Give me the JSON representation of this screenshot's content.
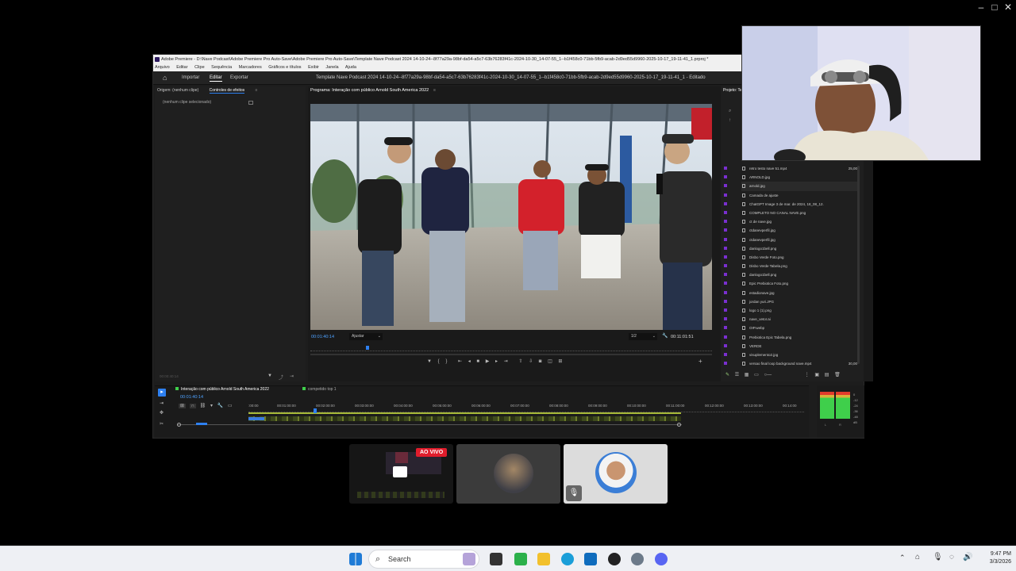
{
  "premiere": {
    "title": "Adobe Premiere - D:\\Nave Podcast\\Adobe Premiere Pro Auto-Save\\Adobe Premiere Pro Auto-Save\\Template Nave Podcast 2024 14-10-24--8f77a29a-98bf-da54-a5c7-63b76283f41c-2024-10-30_14-07-55_1--b1f458c0-71bb-5fb9-acab-2d9ed55d9960-2025-10-17_19-11-41_1.prproj *",
    "menu": [
      "Arquivo",
      "Editar",
      "Clipe",
      "Sequência",
      "Marcadores",
      "Gráficos e títulos",
      "Exibir",
      "Janela",
      "Ajuda"
    ],
    "workspace_tabs": [
      "Importar",
      "Editar",
      "Exportar"
    ],
    "document_title": "Template Nave Podcast 2024 14-10-24--8f77a29a-98bf-da54-a5c7-63b76283f41c-2024-10-30_14-07-55_1--b1f458c0-71bb-5fb9-acab-2d9ed55d9960-2025-10-17_19-11-41_1 - Editado",
    "left_panel": {
      "tabs": [
        "Origem: (nenhum clipe)",
        "Controles de efeitos"
      ],
      "menu_icon": "≡",
      "placeholder": "(nenhum clipe selecionado)",
      "bottom_time": "00:00:40:14"
    },
    "program": {
      "tab": "Programa: Interação com público Arnold South America 2022",
      "menu_icon": "≡",
      "timecode": "00:01:40:14",
      "fit": "Ajustar",
      "resolution": "1/2",
      "duration": "00:11:01:51"
    },
    "project": {
      "tab": "Projeto: Te",
      "files": [
        {
          "name": "retro testo nave 51.mp4",
          "dur": "25,00"
        },
        {
          "name": "ARNOLD.jpg",
          "dur": ""
        },
        {
          "name": "arnold.jpg",
          "dur": ""
        },
        {
          "name": "Camada de ajuste",
          "dur": ""
        },
        {
          "name": "ChatGPT Image 3 de mar. de 2024, 18_08_12.",
          "dur": ""
        },
        {
          "name": "COMPLETO NO CANAL NAVE.png",
          "dur": ""
        },
        {
          "name": "ct de nave.jpg",
          "dur": ""
        },
        {
          "name": "ctdanevperfil.jpg",
          "dur": ""
        },
        {
          "name": "ctdanevperfil.jpg",
          "dur": ""
        },
        {
          "name": "danlogo1bell.png",
          "dur": ""
        },
        {
          "name": "Disbo Verde Foto.png",
          "dur": ""
        },
        {
          "name": "Disbo Verde Tabela.png",
          "dur": ""
        },
        {
          "name": "danlogo1bell.png",
          "dur": ""
        },
        {
          "name": "Epic Prebiotica Foto.png",
          "dur": ""
        },
        {
          "name": "estadionave.jpg",
          "dur": ""
        },
        {
          "name": "jordan yuri.JPG",
          "dur": ""
        },
        {
          "name": "logo 1 (1).png",
          "dur": ""
        },
        {
          "name": "nave_vetor.ai",
          "dur": ""
        },
        {
          "name": "OIP.webp",
          "dur": ""
        },
        {
          "name": "Prebiotica Epic Tabela.png",
          "dur": ""
        },
        {
          "name": "VERDE",
          "dur": ""
        },
        {
          "name": "visuplemento2.jpg",
          "dur": ""
        },
        {
          "name": "versao final loop background nave.mp4",
          "dur": "30,00"
        }
      ]
    },
    "timeline": {
      "tabs": [
        "Interação com público Arnold South America 2022",
        "competido top 1"
      ],
      "timecode": "00:01:40:14",
      "ruler": [
        ":00:00",
        "00:01:00:00",
        "00:02:00:00",
        "00:03:00:00",
        "00:04:00:00",
        "00:05:00:00",
        "00:06:00:00",
        "00:07:00:00",
        "00:08:00:00",
        "00:09:00:00",
        "00:10:00:00",
        "00:11:00:00",
        "00:12:00:00",
        "00:13:00:00",
        "00:14:00"
      ],
      "meter_labels": [
        "0",
        "-12",
        "-24",
        "-36",
        "-48",
        "dB"
      ],
      "meter_lr": [
        "L",
        "R"
      ]
    }
  },
  "meeting": {
    "live_badge": "AO VIVO"
  },
  "taskbar": {
    "search_placeholder": "Search",
    "time": "9:47 PM",
    "date": "3/3/2026"
  },
  "colors": {
    "accent_blue": "#2e80f0",
    "live_red": "#e01d2c",
    "timeline_green": "#a7b938",
    "meter_green": "#3fcf4b"
  }
}
